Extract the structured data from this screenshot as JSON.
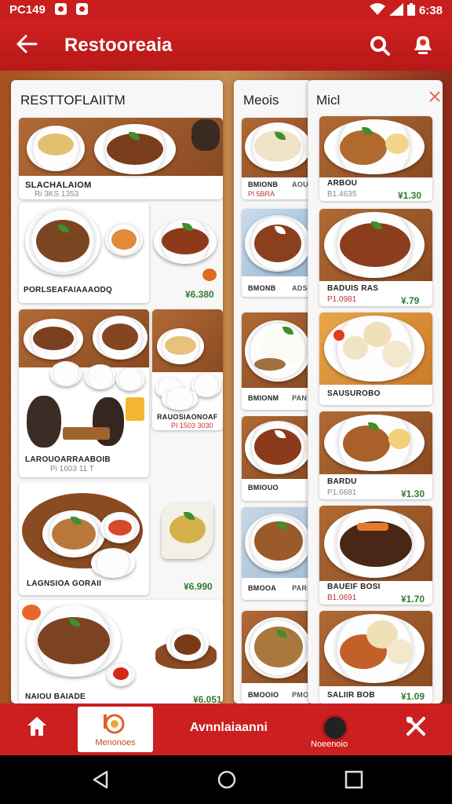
{
  "status_bar": {
    "left_text": "PC149",
    "time": "6:38"
  },
  "app_bar": {
    "title": "Restooreaia"
  },
  "panels": {
    "left": {
      "title": "RESTTOFLAIITM",
      "cards": [
        {
          "label": "SLACHALAIOM",
          "sub": "Ri 3KS 1353"
        },
        {
          "label": "PORLSEAFAIAAAODQ",
          "price": "¥6.380"
        },
        {
          "label": "LAROUOARRAABOIB",
          "sub": "Pi 1603 11 T"
        },
        {
          "label": "LAGNSIOA GORAII",
          "price": "¥6.990"
        },
        {
          "label": "NAIOU BAIADE",
          "price": "¥6.051"
        }
      ],
      "side_items": [
        {
          "label": "RAUOSIAONOAF",
          "sub": "PI 1503 3030"
        }
      ]
    },
    "middle": {
      "title": "Meois",
      "items": [
        {
          "label": "BMIONB",
          "sub": "Pl 5BRA",
          "tag": "AOUE"
        },
        {
          "label": "BMONB",
          "sub": "",
          "tag": "ADSS"
        },
        {
          "label": "BMIONM",
          "sub": "",
          "tag": "PANIE"
        },
        {
          "label": "BMIOUO",
          "sub": "",
          "tag": ""
        },
        {
          "label": "BMOOA",
          "sub": "",
          "tag": "PARIE"
        },
        {
          "label": "BMOOIO",
          "sub": "",
          "tag": "PMOR"
        }
      ]
    },
    "right": {
      "title": "Micl",
      "items": [
        {
          "label": "ARBOU",
          "sub": "B1.4635",
          "price": "¥1.30"
        },
        {
          "label": "BADUIS RAS",
          "sub": "P1.0981",
          "price": "¥.79"
        },
        {
          "label": "SAUSUROBO",
          "sub": "",
          "price": ""
        },
        {
          "label": "BARDU",
          "sub": "P1.6681",
          "price": "¥1.30"
        },
        {
          "label": "BAUEIF BOSI",
          "sub": "B1.0691",
          "price": "¥1.70"
        },
        {
          "label": "SALIIR BOB",
          "sub": "",
          "price": "¥1.09"
        }
      ]
    }
  },
  "bottom_nav": {
    "menu_label": "Menonoes",
    "center_label": "Avnnlaiaanni",
    "orders_label": "Noeenoio"
  },
  "colors": {
    "primary_red": "#cc1f1f",
    "price_green": "#2e7d32"
  }
}
